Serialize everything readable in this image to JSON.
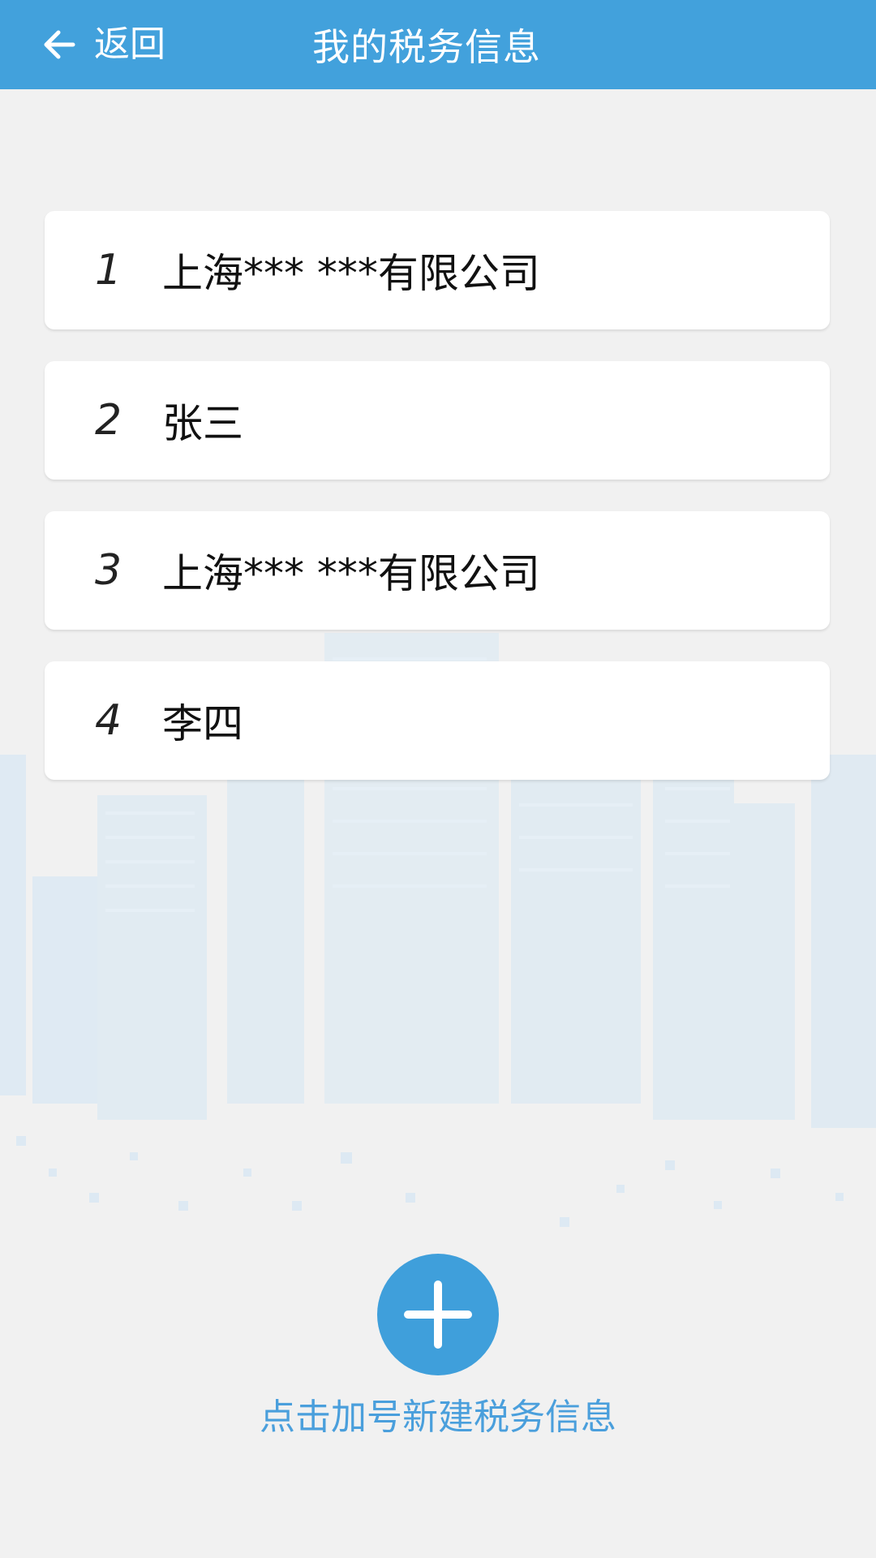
{
  "colors": {
    "header_bg": "#42a1dc",
    "accent": "#3f9fdb",
    "hint_text": "#4a9fdc",
    "page_bg": "#f1f1f1",
    "card_bg": "#ffffff",
    "city_tint": "#d6e6f2"
  },
  "header": {
    "back_icon": "arrow-left-icon",
    "back_label": "返回",
    "title": "我的税务信息"
  },
  "list": {
    "items": [
      {
        "index": "1",
        "name": "上海*** ***有限公司"
      },
      {
        "index": "2",
        "name": "张三"
      },
      {
        "index": "3",
        "name": "上海*** ***有限公司"
      },
      {
        "index": "4",
        "name": "李四"
      }
    ]
  },
  "add": {
    "icon": "plus-icon",
    "hint": "点击加号新建税务信息"
  }
}
